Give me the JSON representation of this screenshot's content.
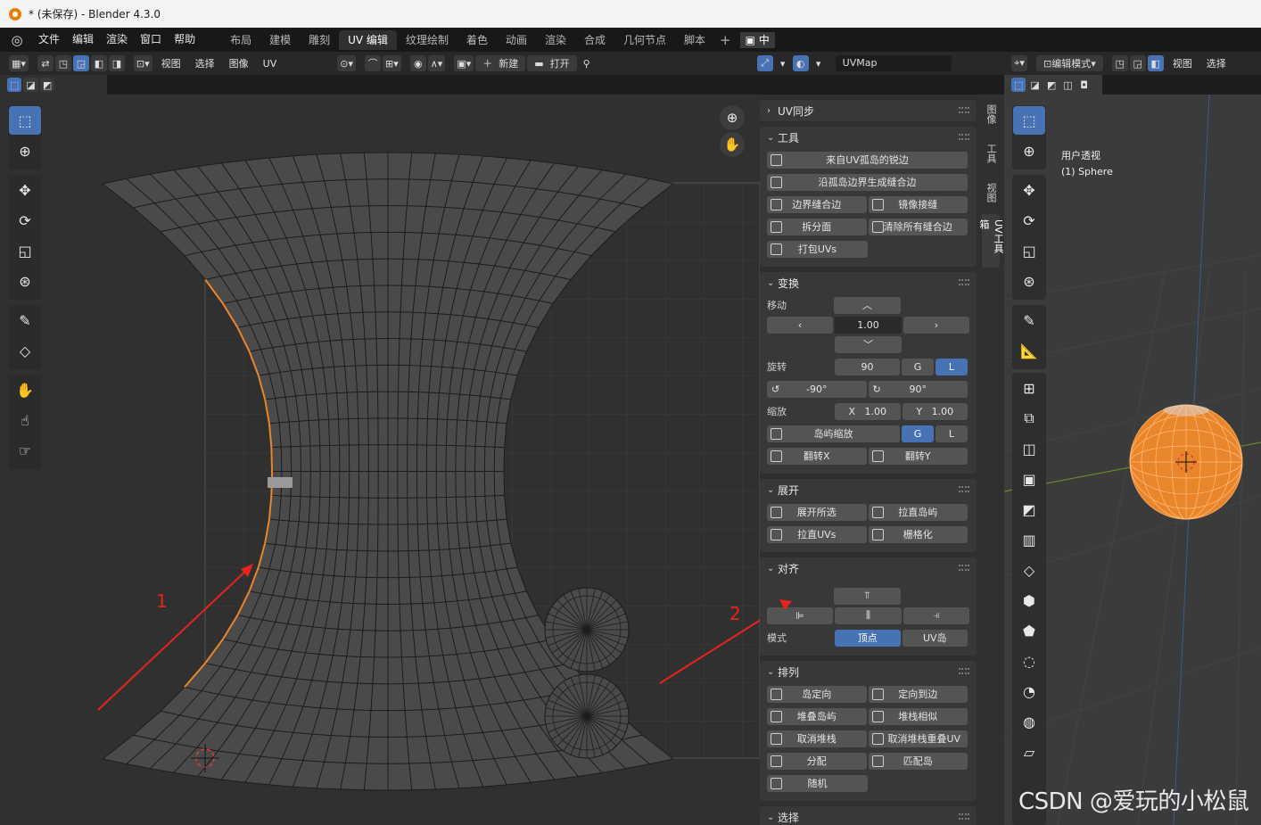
{
  "window": {
    "title": "* (未保存) - Blender 4.3.0"
  },
  "menu": [
    "文件",
    "编辑",
    "渲染",
    "窗口",
    "帮助"
  ],
  "workspaces": [
    {
      "label": "布局",
      "active": false
    },
    {
      "label": "建模",
      "active": false
    },
    {
      "label": "雕刻",
      "active": false
    },
    {
      "label": "UV 编辑",
      "active": true
    },
    {
      "label": "纹理绘制",
      "active": false
    },
    {
      "label": "着色",
      "active": false
    },
    {
      "label": "动画",
      "active": false
    },
    {
      "label": "渲染",
      "active": false
    },
    {
      "label": "合成",
      "active": false
    },
    {
      "label": "几何节点",
      "active": false
    },
    {
      "label": "脚本",
      "active": false
    }
  ],
  "ime": "中",
  "uv_header": {
    "menus": [
      "视图",
      "选择",
      "图像",
      "UV"
    ],
    "new_label": "新建",
    "open_label": "打开",
    "uvmap": "UVMap"
  },
  "v3d_header": {
    "mode": "编辑模式",
    "menus": [
      "视图",
      "选择"
    ]
  },
  "annotations": {
    "arrow1": "1",
    "arrow2": "2"
  },
  "side_tabs": [
    "图像",
    "工具",
    "视图",
    "UV工具箱"
  ],
  "panel": {
    "uv_sync": "UV同步",
    "tools": {
      "title": "工具",
      "seams_from_islands": "来自UV孤岛的锐边",
      "seams_from_border": "沿孤岛边界生成缝合边",
      "border_seam": "边界缝合边",
      "mirror_seam": "镜像接缝",
      "split_face": "拆分面",
      "clear_seams": "清除所有缝合边",
      "pack": "打包UVs"
    },
    "transform": {
      "title": "变换",
      "move_label": "移动",
      "move_value": "1.00",
      "rotate_label": "旋转",
      "rotate_value": "90",
      "g": "G",
      "l": "L",
      "rot_neg": "-90°",
      "rot_pos": "90°",
      "scale_label": "缩放",
      "scale_x_label": "X",
      "scale_x": "1.00",
      "scale_y_label": "Y",
      "scale_y": "1.00",
      "island_scale": "岛屿缩放",
      "flip_x": "翻转X",
      "flip_y": "翻转Y"
    },
    "unwrap": {
      "title": "展开",
      "unwrap_selected": "展开所选",
      "straighten_island": "拉直岛屿",
      "straighten_uvs": "拉直UVs",
      "gridify": "栅格化"
    },
    "align": {
      "title": "对齐",
      "mode_label": "模式",
      "mode_vertex": "顶点",
      "mode_island": "UV岛"
    },
    "arrange": {
      "title": "排列",
      "orient": "岛定向",
      "orient_edge": "定向到边",
      "stack": "堆叠岛屿",
      "stack_similar": "堆栈相似",
      "unstack": "取消堆栈",
      "unstack_overlap": "取消堆栈重叠UV",
      "distribute": "分配",
      "match": "匹配岛",
      "random": "随机"
    },
    "select_title": "选择"
  },
  "viewport3d": {
    "view_name": "用户透视",
    "object": "(1) Sphere"
  },
  "watermark": "CSDN @爱玩的小松鼠",
  "colors": {
    "accent": "#4772b3",
    "orange": "#e9852a",
    "arrow": "#e8231c"
  }
}
